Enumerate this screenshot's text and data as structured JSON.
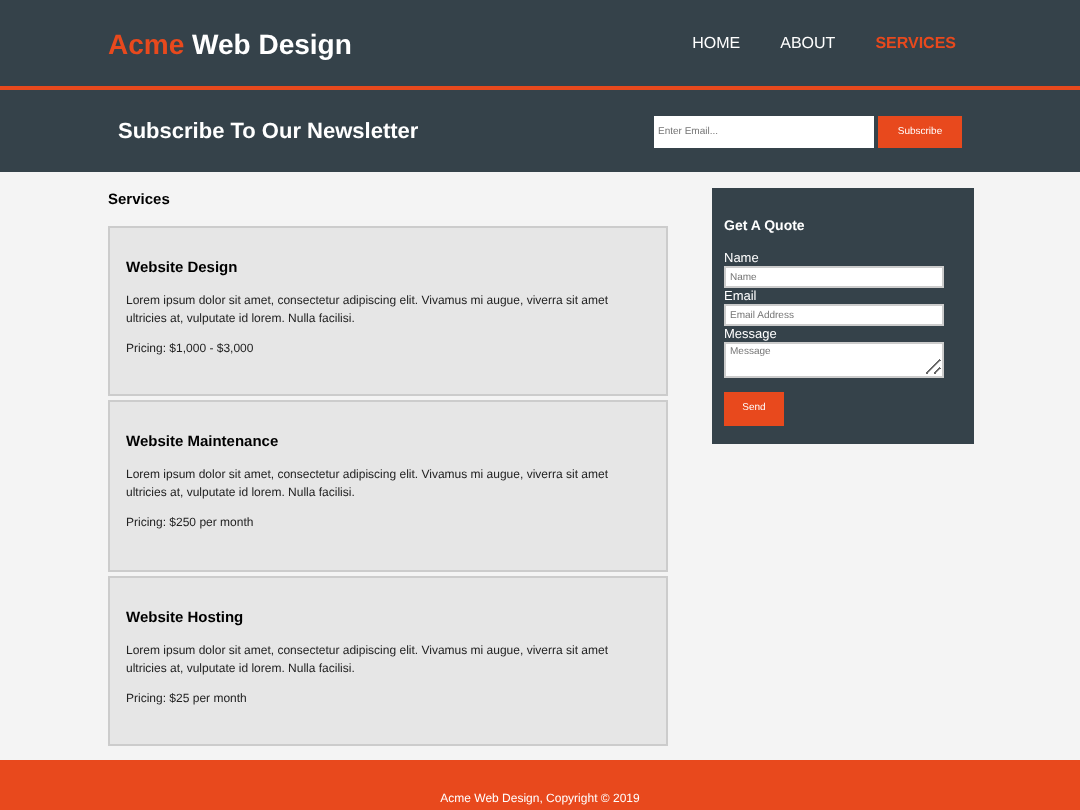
{
  "header": {
    "logo_highlight": "Acme",
    "logo_rest": "Web Design",
    "nav": [
      {
        "label": "HOME",
        "selected": false
      },
      {
        "label": "ABOUT",
        "selected": false
      },
      {
        "label": "SERVICES",
        "selected": true
      }
    ]
  },
  "newsletter": {
    "title": "Subscribe To Our Newsletter",
    "placeholder": "Enter Email...",
    "button": "Subscribe"
  },
  "main": {
    "heading": "Services",
    "services": [
      {
        "title": "Website Design",
        "text": "Lorem ipsum dolor sit amet, consectetur adipiscing elit. Vivamus mi augue, viverra sit amet ultricies at, vulputate id lorem. Nulla facilisi.",
        "pricing": "Pricing: $1,000 - $3,000"
      },
      {
        "title": "Website Maintenance",
        "text": "Lorem ipsum dolor sit amet, consectetur adipiscing elit. Vivamus mi augue, viverra sit amet ultricies at, vulputate id lorem. Nulla facilisi.",
        "pricing": "Pricing: $250 per month"
      },
      {
        "title": "Website Hosting",
        "text": "Lorem ipsum dolor sit amet, consectetur adipiscing elit. Vivamus mi augue, viverra sit amet ultricies at, vulputate id lorem. Nulla facilisi.",
        "pricing": "Pricing: $25 per month"
      }
    ]
  },
  "quote": {
    "title": "Get A Quote",
    "fields": [
      {
        "label": "Name",
        "placeholder": "Name",
        "kind": "input"
      },
      {
        "label": "Email",
        "placeholder": "Email Address",
        "kind": "input"
      },
      {
        "label": "Message",
        "placeholder": "Message",
        "kind": "textarea"
      }
    ],
    "button": "Send"
  },
  "footer": "Acme Web Design, Copyright © 2019"
}
